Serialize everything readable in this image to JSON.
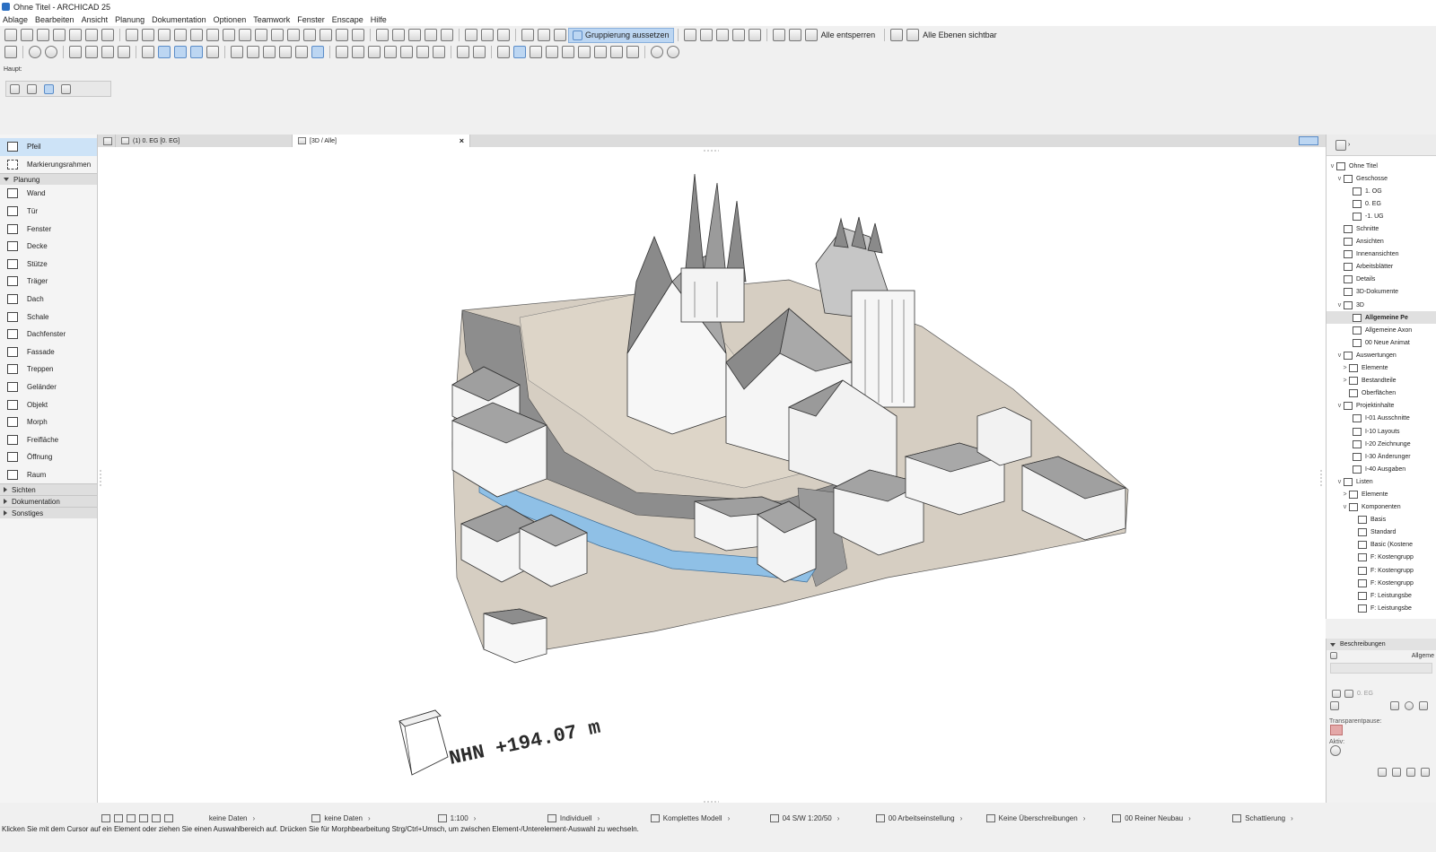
{
  "window": {
    "title": "Ohne Titel - ARCHICAD 25"
  },
  "menu": [
    "Ablage",
    "Bearbeiten",
    "Ansicht",
    "Planung",
    "Dokumentation",
    "Optionen",
    "Teamwork",
    "Fenster",
    "Enscape",
    "Hilfe"
  ],
  "toolbar": {
    "group_suspend_label": "Gruppierung aussetzen",
    "unlock_all_label": "Alle entsperren",
    "all_layers_visible_label": "Alle Ebenen sichtbar"
  },
  "palette": {
    "title": "Haupt:"
  },
  "toolbox": {
    "top_items": [
      "Pfeil",
      "Markierungsrahmen"
    ],
    "group_planung": "Planung",
    "planung_items": [
      "Wand",
      "Tür",
      "Fenster",
      "Decke",
      "Stütze",
      "Träger",
      "Dach",
      "Schale",
      "Dachfenster",
      "Fassade",
      "Treppen",
      "Geländer",
      "Objekt",
      "Morph",
      "Freifläche",
      "Öffnung",
      "Raum"
    ],
    "groups_closed": [
      "Sichten",
      "Dokumentation",
      "Sonstiges"
    ]
  },
  "tabs": [
    {
      "label": "(1) 0. EG [0. EG]"
    },
    {
      "label": "[3D / Alle]"
    }
  ],
  "viewport": {
    "elevation_label": "NHN +194.07 m"
  },
  "statusbar": [
    {
      "label": "keine Daten"
    },
    {
      "label": "keine Daten"
    },
    {
      "label": "1:100"
    },
    {
      "label": "Individuell"
    },
    {
      "label": "Komplettes Modell"
    },
    {
      "label": "04 S/W 1:20/50"
    },
    {
      "label": "00 Arbeitseinstellung"
    },
    {
      "label": "Keine Überschreibungen"
    },
    {
      "label": "00 Reiner Neubau"
    },
    {
      "label": "Schattierung"
    }
  ],
  "hint": "Klicken Sie mit dem Cursor auf ein Element oder ziehen Sie einen Auswahlbereich auf. Drücken Sie für Morphbearbeitung Strg/Ctrl+Umsch, um zwischen Element-/Unterelement-Auswahl zu wechseln.",
  "navigator": {
    "items": [
      {
        "label": "Ohne Titel",
        "exp": "v"
      },
      {
        "label": "Geschosse",
        "exp": "v"
      },
      {
        "label": "1. OG",
        "exp": ""
      },
      {
        "label": "0. EG",
        "exp": ""
      },
      {
        "label": "-1. UG",
        "exp": ""
      },
      {
        "label": "Schnitte",
        "exp": ""
      },
      {
        "label": "Ansichten",
        "exp": ""
      },
      {
        "label": "Innenansichten",
        "exp": ""
      },
      {
        "label": "Arbeitsblätter",
        "exp": ""
      },
      {
        "label": "Details",
        "exp": ""
      },
      {
        "label": "3D-Dokumente",
        "exp": ""
      },
      {
        "label": "3D",
        "exp": "v"
      },
      {
        "label": "Allgemeine Pe",
        "exp": ""
      },
      {
        "label": "Allgemeine Axon",
        "exp": ""
      },
      {
        "label": "00 Neue Animat",
        "exp": ""
      },
      {
        "label": "Auswertungen",
        "exp": "v"
      },
      {
        "label": "Elemente",
        "exp": ">"
      },
      {
        "label": "Bestandteile",
        "exp": ">"
      },
      {
        "label": "Oberflächen",
        "exp": ""
      },
      {
        "label": "Projektinhalte",
        "exp": "v"
      },
      {
        "label": "I-01 Ausschnitte",
        "exp": ""
      },
      {
        "label": "I-10 Layouts",
        "exp": ""
      },
      {
        "label": "I-20 Zeichnunge",
        "exp": ""
      },
      {
        "label": "I-30 Änderunger",
        "exp": ""
      },
      {
        "label": "I-40 Ausgaben",
        "exp": ""
      },
      {
        "label": "Listen",
        "exp": "v"
      },
      {
        "label": "Elemente",
        "exp": ">"
      },
      {
        "label": "Komponenten",
        "exp": "v"
      },
      {
        "label": "Basis",
        "exp": ""
      },
      {
        "label": "Standard",
        "exp": ""
      },
      {
        "label": "Basic (Kostene",
        "exp": ""
      },
      {
        "label": "F: Kostengrupp",
        "exp": ""
      },
      {
        "label": "F: Kostengrupp",
        "exp": ""
      },
      {
        "label": "F: Kostengrupp",
        "exp": ""
      },
      {
        "label": "F: Leistungsbe",
        "exp": ""
      },
      {
        "label": "F: Leistungsbe",
        "exp": ""
      }
    ]
  },
  "beschreibungen": {
    "title": "Beschreibungen",
    "row1": "Allgeme",
    "floor": "0. EG",
    "transparent_label": "Transparentpause:",
    "active_label": "Aktiv:"
  },
  "colors": {
    "accent": "#bcd6f2",
    "water": "#8fc0e6",
    "terrain": "#d6cec2",
    "road": "#8d8d8d"
  }
}
